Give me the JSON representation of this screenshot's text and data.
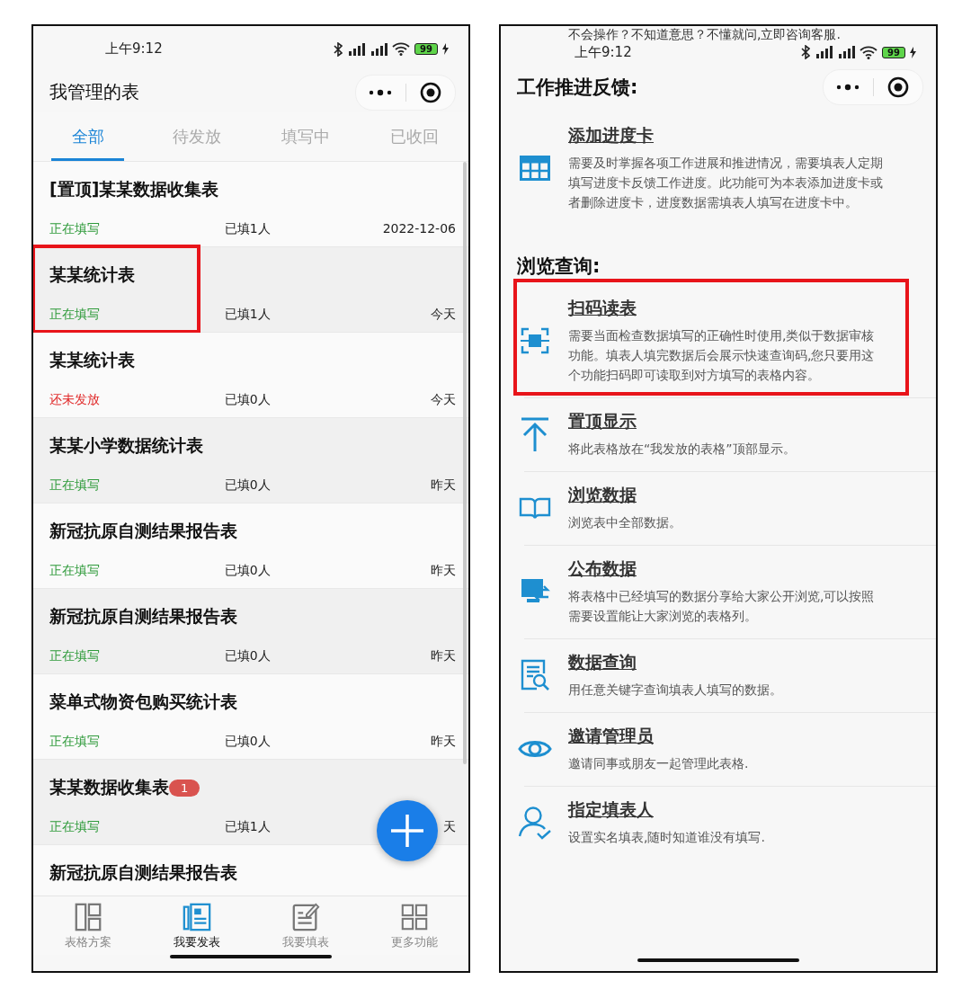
{
  "left_phone": {
    "status_bar": {
      "time": "上午9:12",
      "battery": "99"
    },
    "title": "我管理的表",
    "tabs": [
      {
        "label": "全部",
        "selected": true
      },
      {
        "label": "待发放",
        "selected": false
      },
      {
        "label": "填写中",
        "selected": false
      },
      {
        "label": "已收回",
        "selected": false
      }
    ],
    "rows": [
      {
        "title": "[置顶]某某数据收集表",
        "status": "正在填写",
        "color": "#2e9a3a",
        "filled": "已填1人",
        "date": "2022-12-06",
        "highlighted": false
      },
      {
        "title": "某某统计表",
        "status": "正在填写",
        "color": "#2e9a3a",
        "filled": "已填1人",
        "date": "今天",
        "highlighted": true
      },
      {
        "title": "某某统计表",
        "status": "还未发放",
        "color": "#e02828",
        "filled": "已填0人",
        "date": "今天",
        "highlighted": false
      },
      {
        "title": "某某小学数据统计表",
        "status": "正在填写",
        "color": "#2e9a3a",
        "filled": "已填0人",
        "date": "昨天",
        "highlighted": false
      },
      {
        "title": "新冠抗原自测结果报告表",
        "status": "正在填写",
        "color": "#2e9a3a",
        "filled": "已填0人",
        "date": "昨天",
        "highlighted": false
      },
      {
        "title": "新冠抗原自测结果报告表",
        "status": "正在填写",
        "color": "#2e9a3a",
        "filled": "已填0人",
        "date": "昨天",
        "highlighted": false
      },
      {
        "title": "菜单式物资包购买统计表",
        "status": "正在填写",
        "color": "#2e9a3a",
        "filled": "已填0人",
        "date": "昨天",
        "highlighted": false
      },
      {
        "title": "某某数据收集表",
        "badge": "1",
        "status": "正在填写",
        "color": "#2e9a3a",
        "filled": "已填1人",
        "date": "天",
        "highlighted": false
      },
      {
        "title": "新冠抗原自测结果报告表"
      }
    ],
    "bottom_nav": [
      {
        "label": "表格方案",
        "kind": "layout",
        "selected": false
      },
      {
        "label": "我要发表",
        "kind": "publish",
        "selected": true
      },
      {
        "label": "我要填表",
        "kind": "fill",
        "selected": false
      },
      {
        "label": "更多功能",
        "kind": "more",
        "selected": false
      }
    ]
  },
  "right_phone": {
    "top_note": "不会操作？不知道意思？不懂就问,立即咨询客服.",
    "status_bar": {
      "time": "上午9:12",
      "battery": "99"
    },
    "sections": [
      {
        "heading": "工作推进反馈:",
        "items": [
          {
            "kind": "grid",
            "title": "添加进度卡",
            "description": "需要及时掌握各项工作进展和推进情况，需要填表人定期填写进度卡反馈工作进度。此功能可为本表添加进度卡或者删除进度卡，进度数据需填表人填写在进度卡中。",
            "highlighted": false
          }
        ]
      },
      {
        "heading": "浏览查询:",
        "items": [
          {
            "kind": "scan",
            "title": "扫码读表",
            "description": "需要当面检查数据填写的正确性时使用,类似于数据审核功能。填表人填完数据后会展示快速查询码,您只要用这个功能扫码即可读取到对方填写的表格内容。",
            "highlighted": true
          },
          {
            "kind": "pin",
            "title": "置顶显示",
            "description": "将此表格放在“我发放的表格”顶部显示。",
            "highlighted": false
          },
          {
            "kind": "book",
            "title": "浏览数据",
            "description": "浏览表中全部数据。",
            "highlighted": false
          },
          {
            "kind": "share",
            "title": "公布数据",
            "description": "将表格中已经填写的数据分享给大家公开浏览,可以按照需要设置能让大家浏览的表格列。",
            "highlighted": false
          },
          {
            "kind": "query",
            "title": "数据查询",
            "description": "用任意关键字查询填表人填写的数据。",
            "highlighted": false
          },
          {
            "kind": "eye",
            "title": "邀请管理员",
            "description": "邀请同事或朋友一起管理此表格.",
            "highlighted": false
          },
          {
            "kind": "person",
            "title": "指定填表人",
            "description": "设置实名填表,随时知道谁没有填写.",
            "highlighted": false
          }
        ]
      }
    ]
  }
}
